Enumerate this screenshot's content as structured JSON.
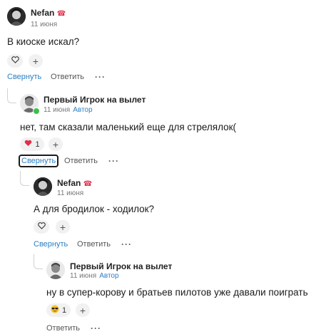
{
  "comments": [
    {
      "author": "Nefan",
      "badge_icon": "phone-emoji-icon",
      "date": "11 июня",
      "author_tag": "",
      "text": "В киоске искал?",
      "reaction": {
        "icon": "heart-outline-icon",
        "count": ""
      },
      "actions": {
        "collapse": "Свернуть",
        "reply": "Ответить",
        "more": "···"
      }
    },
    {
      "author": "Первый Игрок на вылет",
      "date": "11 июня",
      "author_tag": "Автор",
      "text": "нет, там сказали маленький еще для стрелялок(",
      "reaction": {
        "icon": "red-heart-icon",
        "count": "1"
      },
      "actions": {
        "collapse": "Свернуть",
        "reply": "Ответить",
        "more": "···"
      }
    },
    {
      "author": "Nefan",
      "badge_icon": "phone-emoji-icon",
      "date": "11 июня",
      "author_tag": "",
      "text": "А для бродилок - ходилок?",
      "reaction": {
        "icon": "heart-outline-icon",
        "count": ""
      },
      "actions": {
        "collapse": "Свернуть",
        "reply": "Ответить",
        "more": "···"
      }
    },
    {
      "author": "Первый Игрок на вылет",
      "date": "11 июня",
      "author_tag": "Автор",
      "text": "ну в супер-корову и братьев пилотов уже давали поиграть",
      "reaction": {
        "icon": "sunglasses-emoji-icon",
        "count": "1"
      },
      "actions": {
        "reply": "Ответить",
        "more": "···"
      }
    }
  ],
  "colors": {
    "link": "#2b7fc4",
    "online": "#3cc04b",
    "heart": "#e0304a"
  }
}
